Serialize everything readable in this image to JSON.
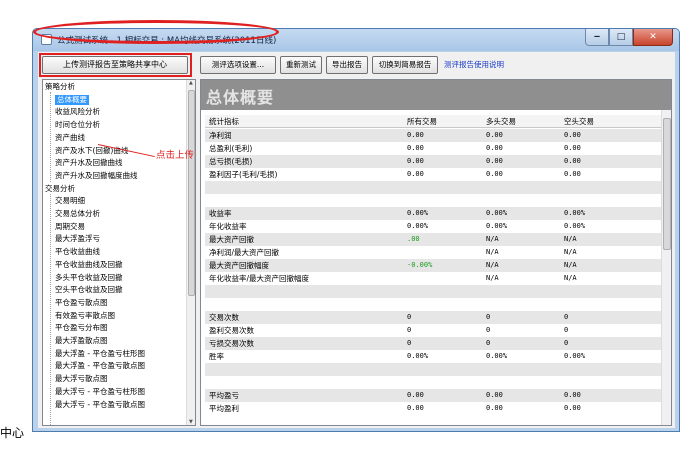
{
  "window": {
    "title": "公式测试系统 - 1.相标交易 : MA均线交易系统(2011日线)",
    "buttons": {
      "minimize": "‒",
      "maximize": "□",
      "close": "✕"
    }
  },
  "toolbar": {
    "upload_label": "上传测评报告至策略共享中心",
    "options_label": "测评选项设置...",
    "retest_label": "重新测试",
    "export_label": "导出报告",
    "simple_label": "切换到简易报告",
    "help_link": "测评报告使用说明"
  },
  "annotation": {
    "click_upload": "点击上传"
  },
  "bottom_left_fragment": "中心",
  "tree": {
    "items": [
      {
        "label": "策略分析",
        "level": 0
      },
      {
        "label": "总体概要",
        "level": 1,
        "selected": true
      },
      {
        "label": "收益风险分析",
        "level": 1
      },
      {
        "label": "时间仓位分析",
        "level": 1
      },
      {
        "label": "资产曲线",
        "level": 1
      },
      {
        "label": "资产及水下(回撤)曲线",
        "level": 1
      },
      {
        "label": "资产升水及回撤曲线",
        "level": 1
      },
      {
        "label": "资产升水及回撤幅度曲线",
        "level": 1
      },
      {
        "label": "交易分析",
        "level": 0
      },
      {
        "label": "交易明细",
        "level": 1
      },
      {
        "label": "交易总体分析",
        "level": 1
      },
      {
        "label": "周期交易",
        "level": 1
      },
      {
        "label": "最大浮盈浮亏",
        "level": 1
      },
      {
        "label": "平仓收益曲线",
        "level": 1
      },
      {
        "label": "平仓收益曲线及回撤",
        "level": 1
      },
      {
        "label": "多头平仓收益及回撤",
        "level": 1
      },
      {
        "label": "空头平仓收益及回撤",
        "level": 1
      },
      {
        "label": "平仓盈亏散点图",
        "level": 1
      },
      {
        "label": "有效盈亏率散点图",
        "level": 1
      },
      {
        "label": "平仓盈亏分布图",
        "level": 1
      },
      {
        "label": "最大浮盈散点图",
        "level": 1
      },
      {
        "label": "最大浮盈 - 平仓盈亏柱形图",
        "level": 1
      },
      {
        "label": "最大浮盈 - 平仓盈亏散点图",
        "level": 1
      },
      {
        "label": "最大浮亏散点图",
        "level": 1
      },
      {
        "label": "最大浮亏 - 平仓盈亏柱形图",
        "level": 1
      },
      {
        "label": "最大浮亏 - 平仓盈亏散点图",
        "level": 1
      }
    ]
  },
  "report": {
    "banner_title": "总体概要",
    "columns": [
      "统计指标",
      "所有交易",
      "多头交易",
      "空头交易"
    ],
    "rows": [
      {
        "cells": [
          "净利润",
          "0.00",
          "0.00",
          "0.00"
        ],
        "shaded": true
      },
      {
        "cells": [
          "总盈利(毛利)",
          "0.00",
          "0.00",
          "0.00"
        ],
        "shaded": false
      },
      {
        "cells": [
          "总亏损(毛损)",
          "0.00",
          "0.00",
          "0.00"
        ],
        "shaded": true
      },
      {
        "cells": [
          "盈利因子(毛利/毛损)",
          "0.00",
          "0.00",
          "0.00"
        ],
        "shaded": false
      },
      {
        "cells": [
          "",
          "",
          "",
          ""
        ],
        "shaded": true
      },
      {
        "cells": [
          "",
          "",
          "",
          ""
        ],
        "shaded": false
      },
      {
        "cells": [
          "收益率",
          "0.00%",
          "0.00%",
          "0.00%"
        ],
        "shaded": true
      },
      {
        "cells": [
          "年化收益率",
          "0.00%",
          "0.00%",
          "0.00%"
        ],
        "shaded": false
      },
      {
        "cells": [
          "最大资产回撤",
          ".00",
          "N/A",
          "N/A"
        ],
        "shaded": true,
        "green": 1
      },
      {
        "cells": [
          "净利润/最大资产回撤",
          "",
          "N/A",
          "N/A"
        ],
        "shaded": false
      },
      {
        "cells": [
          "最大资产回撤幅度",
          "-0.00%",
          "N/A",
          "N/A"
        ],
        "shaded": true,
        "green": 1
      },
      {
        "cells": [
          "年化收益率/最大资产回撤幅度",
          "",
          "N/A",
          "N/A"
        ],
        "shaded": false
      },
      {
        "cells": [
          "",
          "",
          "",
          ""
        ],
        "shaded": true
      },
      {
        "cells": [
          "",
          "",
          "",
          ""
        ],
        "shaded": false
      },
      {
        "cells": [
          "交易次数",
          "0",
          "0",
          "0"
        ],
        "shaded": true
      },
      {
        "cells": [
          "盈利交易次数",
          "0",
          "0",
          "0"
        ],
        "shaded": false
      },
      {
        "cells": [
          "亏损交易次数",
          "0",
          "0",
          "0"
        ],
        "shaded": true
      },
      {
        "cells": [
          "胜率",
          "0.00%",
          "0.00%",
          "0.00%"
        ],
        "shaded": false
      },
      {
        "cells": [
          "",
          "",
          "",
          ""
        ],
        "shaded": true
      },
      {
        "cells": [
          "",
          "",
          "",
          ""
        ],
        "shaded": false
      },
      {
        "cells": [
          "平均盈亏",
          "0.00",
          "0.00",
          "0.00"
        ],
        "shaded": true
      },
      {
        "cells": [
          "平均盈利",
          "0.00",
          "0.00",
          "0.00"
        ],
        "shaded": false
      }
    ]
  }
}
